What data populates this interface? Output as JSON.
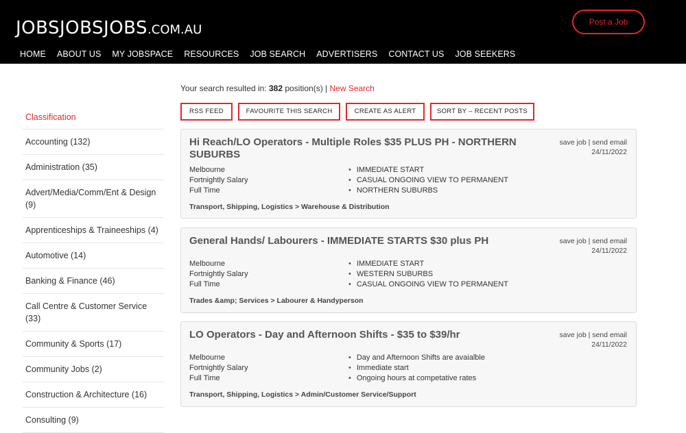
{
  "header": {
    "logo_main": "JOBSJOBSJOBS",
    "logo_tld": ".COM.AU",
    "post_job": "Post a Job",
    "nav": [
      "HOME",
      "ABOUT US",
      "MY JOBSPACE",
      "RESOURCES",
      "JOB SEARCH",
      "ADVERTISERS",
      "CONTACT US",
      "JOB SEEKERS"
    ]
  },
  "sidebar": {
    "heading": "Classification",
    "items": [
      "Accounting (132)",
      "Administration (35)",
      "Advert/Media/Comm/Ent & Design (9)",
      "Apprenticeships & Traineeships (4)",
      "Automotive (14)",
      "Banking & Finance (46)",
      "Call Centre & Customer Service (33)",
      "Community & Sports (17)",
      "Community Jobs (2)",
      "Construction & Architecture (16)",
      "Consulting (9)"
    ]
  },
  "search": {
    "prefix": "Your search resulted in: ",
    "count": "382",
    "suffix": " position(s) | ",
    "new_search": "New Search"
  },
  "actions": {
    "rss": "RSS FEED",
    "favourite": "FAVOURITE THIS SEARCH",
    "alert": "CREATE AS ALERT",
    "sort": "SORT BY – RECENT POSTS"
  },
  "jobs": [
    {
      "title": "Hi Reach/LO Operators - Multiple Roles $35 PLUS PH - NORTHERN SUBURBS",
      "save": "save job",
      "send": "send email",
      "date": "24/11/2022",
      "location": "Melbourne",
      "salary": "Fortnightly Salary",
      "type": "Full Time",
      "bullets": [
        "IMMEDIATE START",
        "CASUAL ONGOING VIEW TO PERMANENT",
        "NORTHERN SUBURBS"
      ],
      "category": "Transport, Shipping, Logistics > Warehouse & Distribution"
    },
    {
      "title": "General Hands/ Labourers - IMMEDIATE STARTS $30 plus PH",
      "save": "save job",
      "send": "send email",
      "date": "24/11/2022",
      "location": "Melbourne",
      "salary": "Fortnightly Salary",
      "type": "Full Time",
      "bullets": [
        "IMMEDIATE START",
        "WESTERN SUBURBS",
        "CASUAL ONGOING VIEW TO PERMANENT"
      ],
      "category": "Trades &amp; Services > Labourer & Handyperson"
    },
    {
      "title": "LO Operators - Day and Afternoon Shifts - $35 to $39/hr",
      "save": "save job",
      "send": "send email",
      "date": "24/11/2022",
      "location": "Melbourne",
      "salary": "Fortnightly Salary",
      "type": "Full Time",
      "bullets": [
        "Day and Afternoon Shifts are avaialble",
        "Immediate start",
        "Ongoing hours at competative rates"
      ],
      "category": "Transport, Shipping, Logistics > Admin/Customer Service/Support"
    }
  ]
}
